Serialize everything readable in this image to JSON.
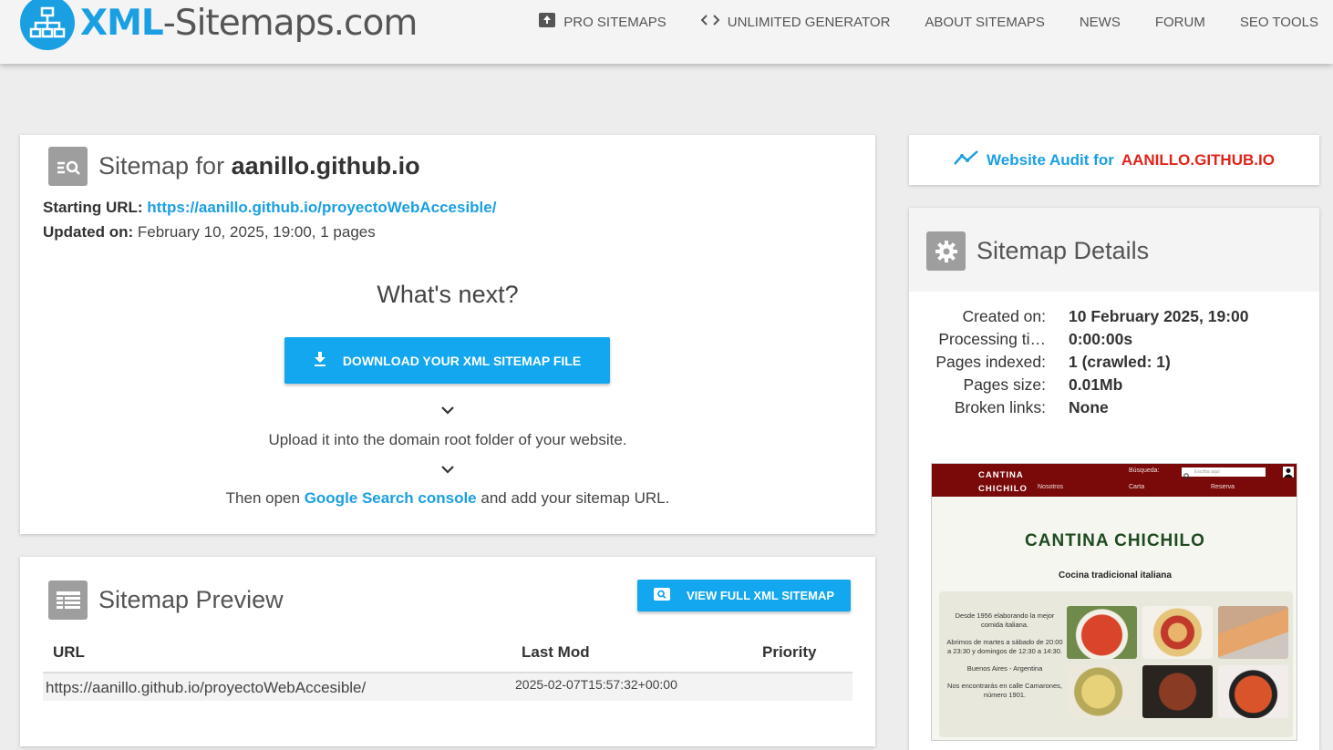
{
  "header": {
    "logo_bold": "XML",
    "logo_rest": "-Sitemaps.com",
    "nav": [
      {
        "label": "PRO SITEMAPS",
        "icon": "pro-sitemaps-icon"
      },
      {
        "label": "UNLIMITED GENERATOR",
        "icon": "code-icon"
      },
      {
        "label": "ABOUT SITEMAPS"
      },
      {
        "label": "NEWS"
      },
      {
        "label": "FORUM"
      },
      {
        "label": "SEO TOOLS"
      }
    ]
  },
  "main": {
    "title_prefix": "Sitemap for",
    "domain": "aanillo.github.io",
    "starting_url_label": "Starting URL:",
    "starting_url": "https://aanillo.github.io/proyectoWebAccesible/",
    "updated_label": "Updated on:",
    "updated_value": "February 10, 2025, 19:00, 1 pages",
    "whats_next": "What's next?",
    "download_button": "DOWNLOAD YOUR XML SITEMAP FILE",
    "upload_text": "Upload it into the domain root folder of your website.",
    "then_open": "Then open",
    "gsc_link": "Google Search console",
    "add_sitemap": "and add your sitemap URL."
  },
  "preview": {
    "title": "Sitemap Preview",
    "view_button": "VIEW FULL XML SITEMAP",
    "columns": [
      "URL",
      "Last Mod",
      "Priority"
    ],
    "rows": [
      {
        "url": "https://aanillo.github.io/proyectoWebAccesible/",
        "lastmod": "2025-02-07T15:57:32+00:00",
        "priority": ""
      }
    ]
  },
  "audit": {
    "prefix": "Website Audit for",
    "domain": "AANILLO.GITHUB.IO"
  },
  "details": {
    "title": "Sitemap Details",
    "rows": [
      {
        "label": "Created on:",
        "value": "10 February 2025, 19:00"
      },
      {
        "label": "Processing ti…",
        "value": "0:00:00s"
      },
      {
        "label": "Pages indexed:",
        "value": "1 (crawled: 1)"
      },
      {
        "label": "Pages size:",
        "value": "0.01Mb"
      },
      {
        "label": "Broken links:",
        "value": "None"
      }
    ]
  },
  "thumbnail": {
    "brand_line1": "CANTINA",
    "brand_line2": "CHICHILO",
    "nav_nosotros": "Nosotros",
    "nav_carta": "Carta",
    "nav_reserva": "Reserva",
    "search_label": "Búsqueda:",
    "search_placeholder": "Escriba aquí",
    "title": "CANTINA CHICHILO",
    "subtitle": "Cocina tradicional italiana",
    "para1": "Desde 1956 elaborando la mejor comida italiana.",
    "para2": "Abrimos de martes a sábado de 20:00 a 23:30 y domingos de 12:30 a 14:30.",
    "para3": "Buenos Aires - Argentina",
    "para4": "Nos encontrarás en calle Camarones, número 1901."
  },
  "colors": {
    "accent": "#1a9fe3",
    "button": "#12a7ee",
    "audit_domain": "#e2231a",
    "icon_gray": "#9e9e9e"
  }
}
